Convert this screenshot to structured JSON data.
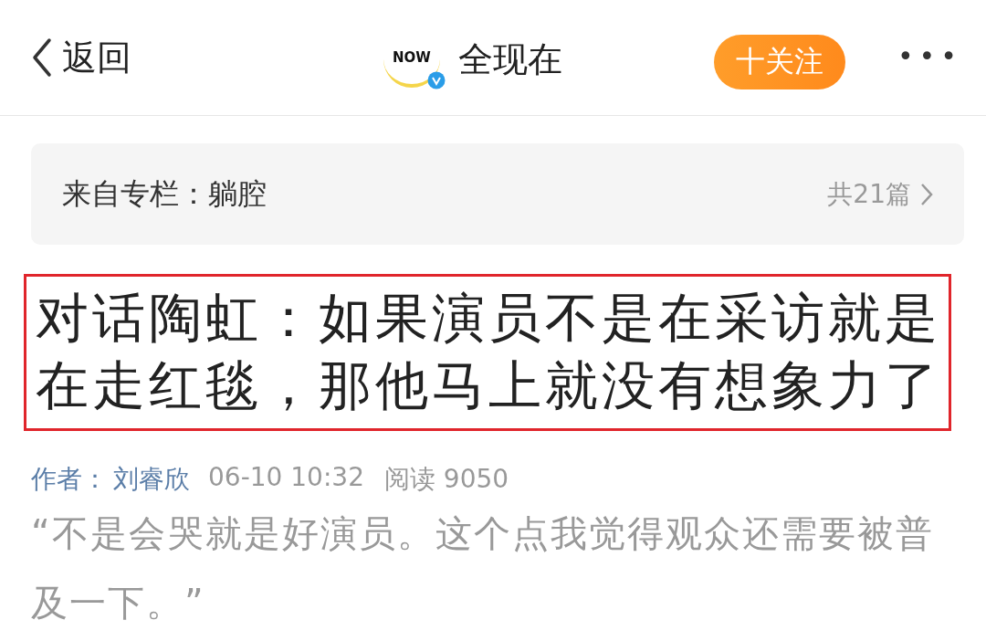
{
  "nav": {
    "back": "返回",
    "logo": "NOW",
    "verified": true,
    "account": "全现在",
    "follow": "十关注",
    "more": "•••"
  },
  "column": {
    "label": "来自专栏：躺腔",
    "count": "共21篇"
  },
  "article": {
    "title": "对话陶虹：如果演员不是在采访就是在走红毯，那他马上就没有想象力了",
    "highlighted": true,
    "author_label": "作者：",
    "author": "刘睿欣",
    "time": "06-10 10:32",
    "reads": "阅读 9050",
    "quote": "“不是会哭就是好演员。这个点我觉得观众还需要被普及一下。”"
  }
}
